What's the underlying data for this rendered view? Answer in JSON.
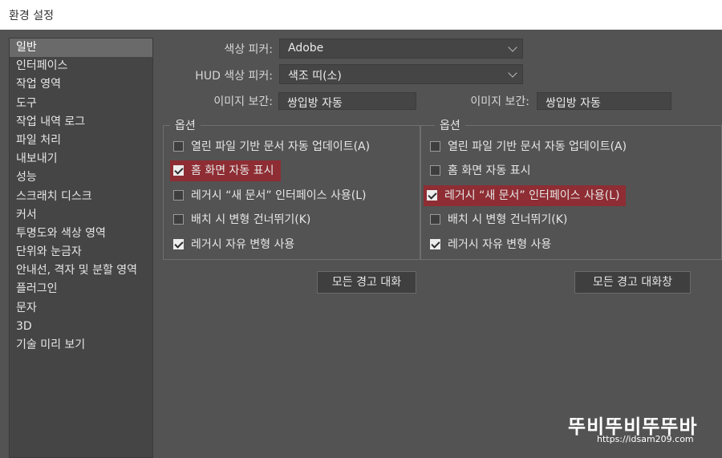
{
  "window": {
    "title": "환경 설정"
  },
  "sidebar": {
    "items": [
      {
        "label": "일반",
        "active": true
      },
      {
        "label": "인터페이스"
      },
      {
        "label": "작업 영역"
      },
      {
        "label": "도구"
      },
      {
        "label": "작업 내역 로그"
      },
      {
        "label": "파일 처리"
      },
      {
        "label": "내보내기"
      },
      {
        "label": "성능"
      },
      {
        "label": "스크래치 디스크"
      },
      {
        "label": "커서"
      },
      {
        "label": "투명도와 색상 영역"
      },
      {
        "label": "단위와 눈금자"
      },
      {
        "label": "안내선, 격자 및 분할 영역"
      },
      {
        "label": "플러그인"
      },
      {
        "label": "문자"
      },
      {
        "label": "3D"
      },
      {
        "label": "기술 미리 보기"
      }
    ]
  },
  "settings": {
    "color_picker": {
      "label": "색상 피커:",
      "value": "Adobe"
    },
    "hud_color_picker": {
      "label": "HUD 색상 피커:",
      "value": "색조 띠(소)"
    },
    "image_interpolation_left": {
      "label": "이미지 보간:",
      "value": "쌍입방 자동"
    },
    "image_interpolation_right": {
      "label": "이미지 보간:",
      "value": "쌍입방 자동"
    }
  },
  "options_left": {
    "title": "옵션",
    "items": [
      {
        "label": "열린 파일 기반 문서 자동 업데이트(A)",
        "checked": false,
        "highlighted": false
      },
      {
        "label": "홈 화면 자동 표시",
        "checked": true,
        "highlighted": true
      },
      {
        "label": "레거시 “새 문서” 인터페이스 사용(L)",
        "checked": false,
        "highlighted": false
      },
      {
        "label": "배치 시 변형 건너뛰기(K)",
        "checked": false,
        "highlighted": false
      },
      {
        "label": "레거시 자유 변형 사용",
        "checked": true,
        "highlighted": false
      }
    ]
  },
  "options_right": {
    "title": "옵션",
    "items": [
      {
        "label": "열린 파일 기반 문서 자동 업데이트(A)",
        "checked": false,
        "highlighted": false
      },
      {
        "label": "홈 화면 자동 표시",
        "checked": false,
        "highlighted": false
      },
      {
        "label": "레거시 “새 문서” 인터페이스 사용(L)",
        "checked": true,
        "highlighted": true
      },
      {
        "label": "배치 시 변형 건너뛰기(K)",
        "checked": false,
        "highlighted": false
      },
      {
        "label": "레거시 자유 변형 사용",
        "checked": true,
        "highlighted": false
      }
    ]
  },
  "buttons": {
    "reset_warnings_left": "모든 경고 대화",
    "reset_warnings_right": "모든 경고 대화창"
  },
  "watermark": {
    "logo": "뚜비뚜비뚜뚜바",
    "url": "https://idsam209.com"
  },
  "colors": {
    "highlight": "#8e2d33",
    "background": "#535353",
    "panel": "#454545"
  }
}
